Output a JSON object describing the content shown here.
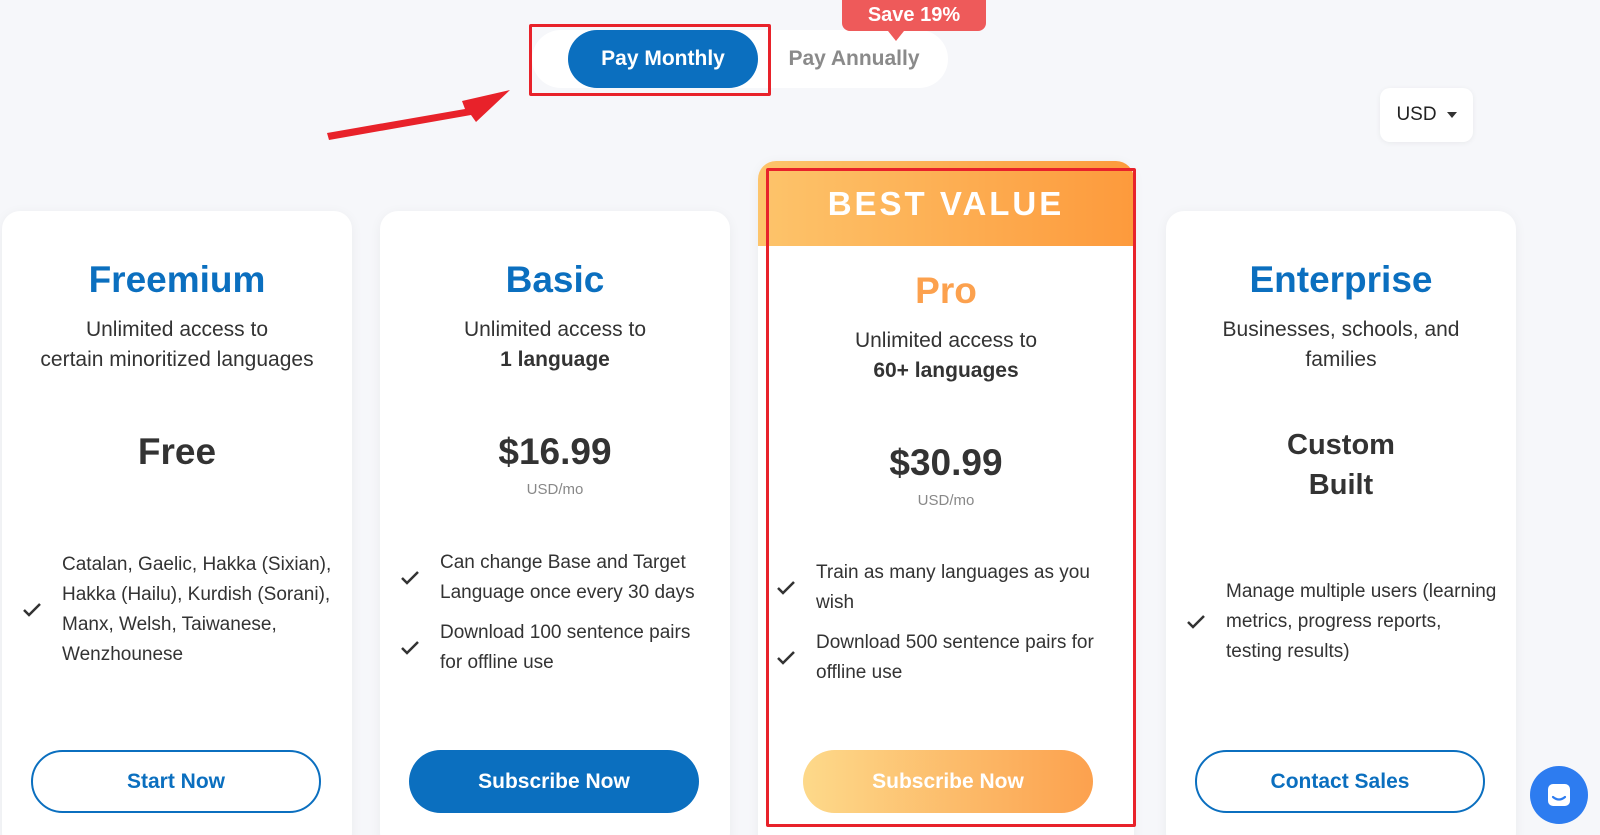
{
  "billing_toggle": {
    "monthly_label": "Pay Monthly",
    "annually_label": "Pay Annually",
    "save_badge": "Save 19%",
    "selected": "monthly"
  },
  "currency": {
    "selected": "USD"
  },
  "colors": {
    "brand_blue": "#0b6fbf",
    "orange_start": "#fdc46b",
    "orange_end": "#fd9a3c",
    "highlight_red": "#e8222a",
    "badge_red": "#ee5a5a"
  },
  "plans": [
    {
      "title": "Freemium",
      "sub_line1": "Unlimited access to",
      "sub_line2": "certain minoritized languages",
      "price": "Free",
      "unit": "",
      "features": [
        "Catalan, Gaelic, Hakka (Sixian), Hakka (Hailu), Kurdish (Sorani), Manx, Welsh, Taiwanese, Wenzhounese"
      ],
      "button": "Start Now"
    },
    {
      "title": "Basic",
      "sub_line1": "Unlimited access to",
      "sub_line2": "1 language",
      "price": "$16.99",
      "unit": "USD/mo",
      "features": [
        "Can change Base and Target Language once every 30 days",
        "Download 100 sentence pairs for offline use"
      ],
      "button": "Subscribe Now"
    },
    {
      "banner": "BEST VALUE",
      "title": "Pro",
      "sub_line1": "Unlimited access to",
      "sub_line2": "60+ languages",
      "price": "$30.99",
      "unit": "USD/mo",
      "features": [
        "Train as many languages as you wish",
        "Download 500 sentence pairs for offline use"
      ],
      "button": "Subscribe Now"
    },
    {
      "title": "Enterprise",
      "sub_line1": "Businesses, schools, and",
      "sub_line2": "families",
      "price_line1": "Custom",
      "price_line2": "Built",
      "features": [
        "Manage multiple users (learning metrics, progress reports, testing results)"
      ],
      "button": "Contact Sales"
    }
  ]
}
